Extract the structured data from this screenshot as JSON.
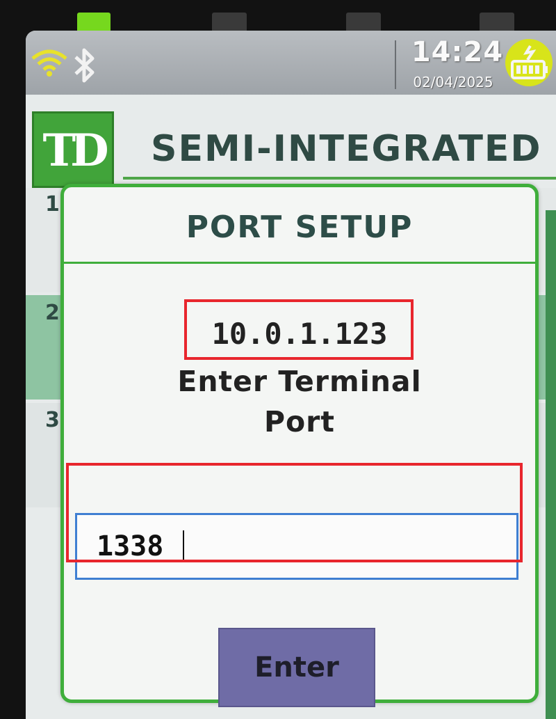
{
  "device": {
    "status_bar": {
      "time": "14:24",
      "date": "02/04/2025",
      "icons": [
        "wifi-icon",
        "bluetooth-icon",
        "battery-charging-icon"
      ]
    },
    "header": {
      "logo_text": "TD",
      "title": "SEMI-INTEGRATED"
    },
    "background_rows": [
      "1",
      "2",
      "3"
    ]
  },
  "dialog": {
    "title": "PORT SETUP",
    "ip_address": "10.0.1.123",
    "prompt_line1": "Enter Terminal",
    "prompt_line2": "Port",
    "port_value": "1338",
    "enter_label": "Enter"
  },
  "colors": {
    "brand_green": "#41a43a",
    "dialog_border": "#3fae3b",
    "input_border": "#3f7fd2",
    "button_bg": "#6f6ca6",
    "annotation_red": "#e8262d"
  }
}
